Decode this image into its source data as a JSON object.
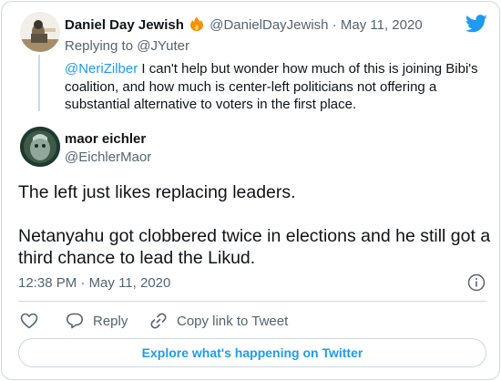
{
  "parent_tweet": {
    "name": "Daniel Day Jewish",
    "handle": "@DanielDayJewish",
    "separator": "·",
    "date": "May 11, 2020",
    "replying_prefix": "Replying to",
    "replying_handle": "@JYuter",
    "mention": "@NeriZilber",
    "text": " I can't help but wonder how much of this is joining Bibi's coalition, and how much is center-left politicians not offering a substantial alternative to voters in the first place."
  },
  "main_tweet": {
    "name": "maor eichler",
    "handle": "@EichlerMaor",
    "paragraph_1": "The left just likes replacing leaders.",
    "paragraph_2": "Netanyahu got clobbered twice in elections and he still got a third chance to lead the Likud.",
    "time": "12:38 PM",
    "separator": "·",
    "date": "May 11, 2020"
  },
  "actions": {
    "reply": "Reply",
    "copy_link": "Copy link to Tweet"
  },
  "explore_label": "Explore what's happening on Twitter",
  "colors": {
    "accent": "#1d9bf0",
    "secondary_text": "#536471",
    "border": "#cfd9de"
  },
  "icons": [
    "twitter-bird-icon",
    "fire-icon",
    "info-icon",
    "heart-icon",
    "reply-icon",
    "link-icon"
  ]
}
